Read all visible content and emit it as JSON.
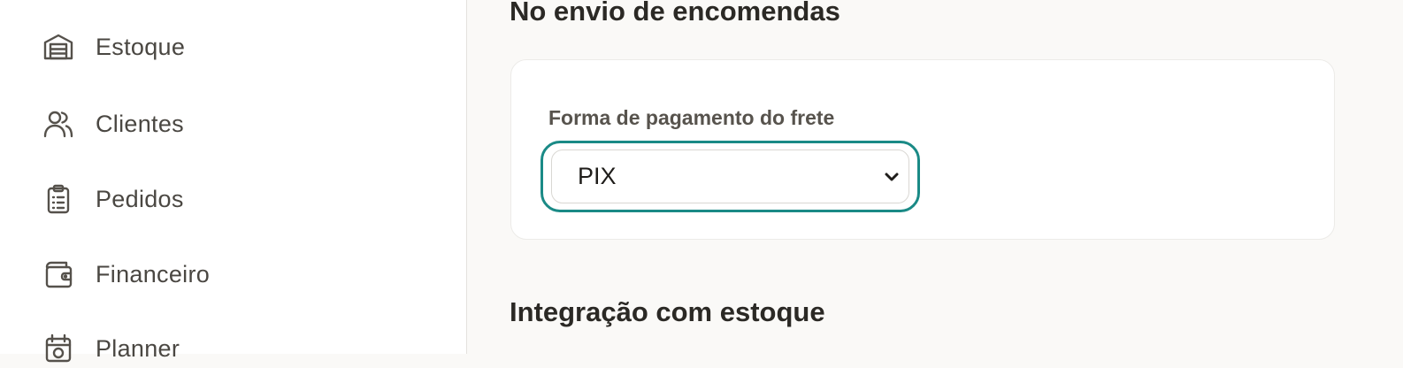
{
  "sidebar": {
    "items": [
      {
        "label": "Estoque",
        "icon": "warehouse-icon"
      },
      {
        "label": "Clientes",
        "icon": "users-icon"
      },
      {
        "label": "Pedidos",
        "icon": "clipboard-list-icon"
      },
      {
        "label": "Financeiro",
        "icon": "wallet-icon"
      },
      {
        "label": "Planner",
        "icon": "calendar-icon"
      }
    ]
  },
  "main": {
    "shipping_section_title": "No envio de encomendas",
    "freight_payment": {
      "label": "Forma de pagamento do frete",
      "selected": "PIX"
    },
    "inventory_section_title": "Integração com estoque"
  },
  "colors": {
    "accent": "#1a8a86",
    "sidebar_text": "#4a4742",
    "background": "#faf9f7"
  }
}
